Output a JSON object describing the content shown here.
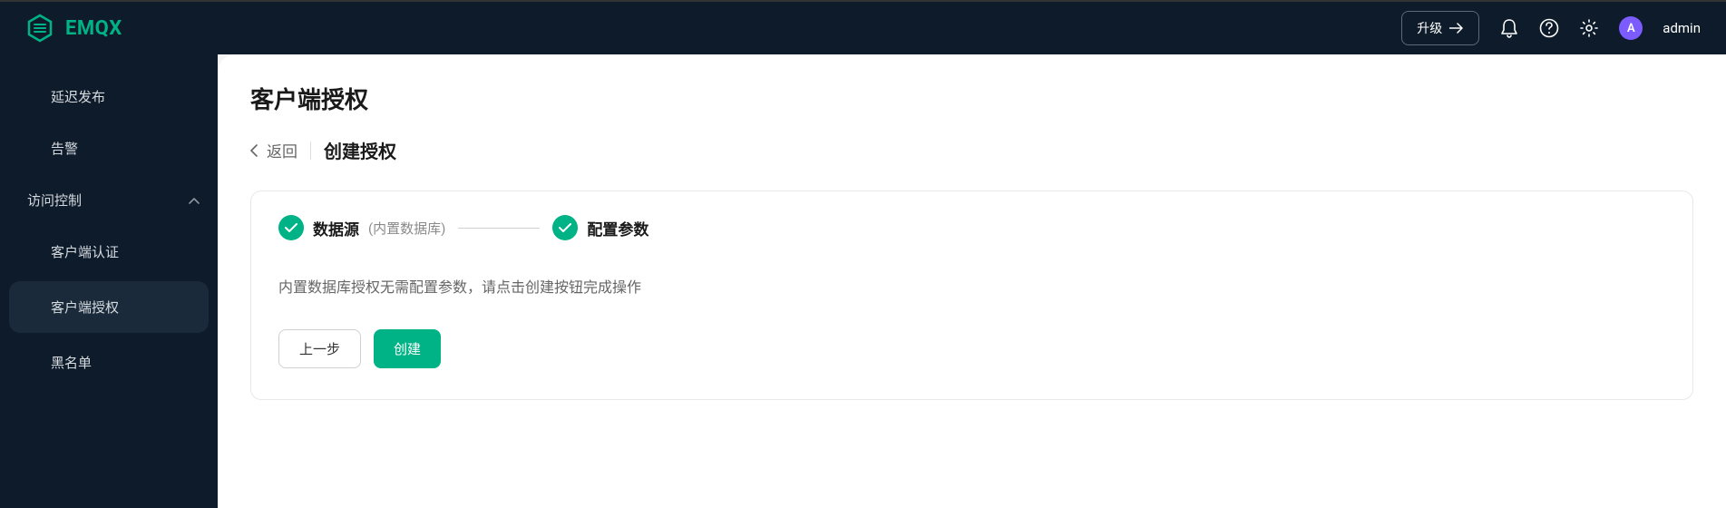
{
  "header": {
    "brand": "EMQX",
    "upgrade_label": "升级",
    "avatar_letter": "A",
    "username": "admin"
  },
  "sidebar": {
    "items": [
      {
        "label": "延迟发布",
        "type": "item",
        "active": false
      },
      {
        "label": "告警",
        "type": "item",
        "active": false
      },
      {
        "label": "访问控制",
        "type": "section",
        "expanded": true
      },
      {
        "label": "客户端认证",
        "type": "item",
        "active": false
      },
      {
        "label": "客户端授权",
        "type": "item",
        "active": true
      },
      {
        "label": "黑名单",
        "type": "item",
        "active": false
      }
    ]
  },
  "main": {
    "page_title": "客户端授权",
    "back_label": "返回",
    "sub_title": "创建授权",
    "steps": [
      {
        "title": "数据源",
        "desc": "(内置数据库)"
      },
      {
        "title": "配置参数",
        "desc": ""
      }
    ],
    "description": "内置数据库授权无需配置参数，请点击创建按钮完成操作",
    "btn_prev": "上一步",
    "btn_create": "创建"
  }
}
